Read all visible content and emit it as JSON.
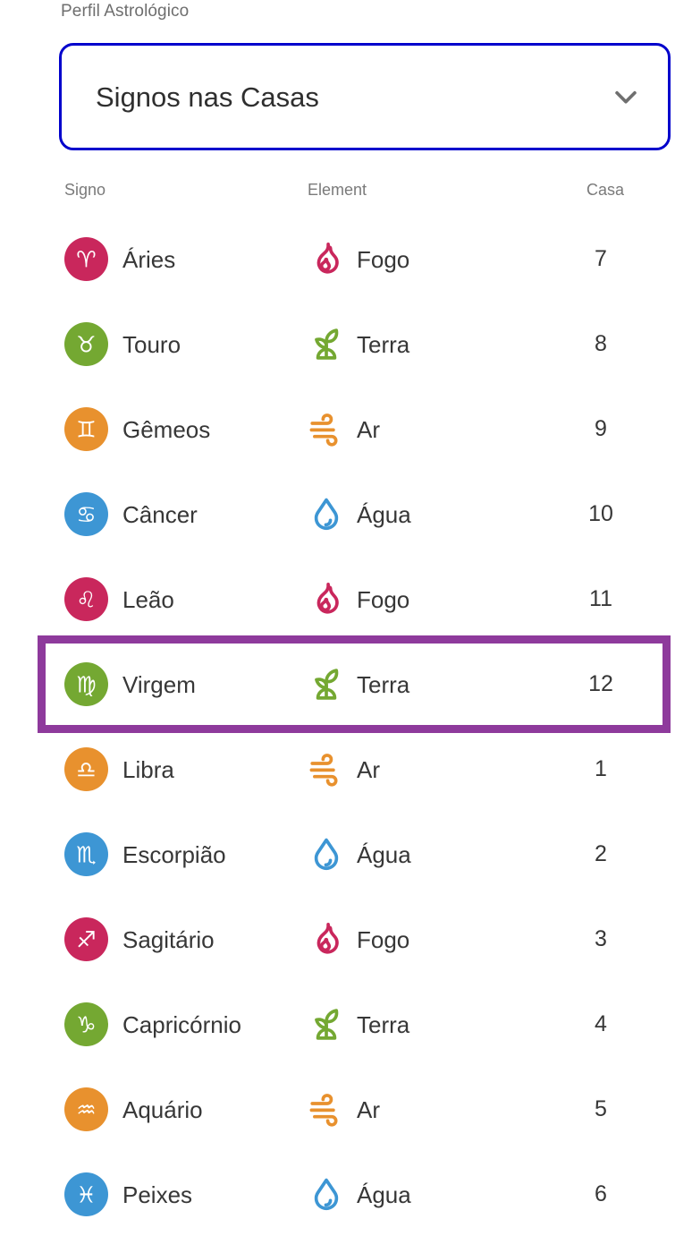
{
  "form": {
    "label": "Perfil Astrológico",
    "select": {
      "name": "perfil-astrologico-select",
      "value": "Signos nas Casas",
      "chevron_icon": "chevron-down-icon",
      "border_color": "#0000cc"
    }
  },
  "table": {
    "headers": {
      "signo": "Signo",
      "element": "Element",
      "casa": "Casa"
    },
    "highlight": {
      "row_index": 5,
      "row_label": "Virgem",
      "color": "#8e3a9c"
    },
    "rows": [
      {
        "sign": "Áries",
        "sign_glyph": "♈",
        "sign_color": "#c9275c",
        "element": "Fogo",
        "element_icon": "flame-icon",
        "element_color": "#c9275c",
        "house": "7"
      },
      {
        "sign": "Touro",
        "sign_glyph": "♉",
        "sign_color": "#74a832",
        "element": "Terra",
        "element_icon": "sprout-icon",
        "element_color": "#74a832",
        "house": "8"
      },
      {
        "sign": "Gêmeos",
        "sign_glyph": "♊",
        "sign_color": "#e8912e",
        "element": "Ar",
        "element_icon": "wind-icon",
        "element_color": "#e8912e",
        "house": "9"
      },
      {
        "sign": "Câncer",
        "sign_glyph": "♋",
        "sign_color": "#3d96d4",
        "element": "Água",
        "element_icon": "droplet-icon",
        "element_color": "#3d96d4",
        "house": "10"
      },
      {
        "sign": "Leão",
        "sign_glyph": "♌",
        "sign_color": "#c9275c",
        "element": "Fogo",
        "element_icon": "flame-icon",
        "element_color": "#c9275c",
        "house": "11"
      },
      {
        "sign": "Virgem",
        "sign_glyph": "♍",
        "sign_color": "#74a832",
        "element": "Terra",
        "element_icon": "sprout-icon",
        "element_color": "#74a832",
        "house": "12"
      },
      {
        "sign": "Libra",
        "sign_glyph": "♎",
        "sign_color": "#e8912e",
        "element": "Ar",
        "element_icon": "wind-icon",
        "element_color": "#e8912e",
        "house": "1"
      },
      {
        "sign": "Escorpião",
        "sign_glyph": "♏",
        "sign_color": "#3d96d4",
        "element": "Água",
        "element_icon": "droplet-icon",
        "element_color": "#3d96d4",
        "house": "2"
      },
      {
        "sign": "Sagitário",
        "sign_glyph": "♐",
        "sign_color": "#c9275c",
        "element": "Fogo",
        "element_icon": "flame-icon",
        "element_color": "#c9275c",
        "house": "3"
      },
      {
        "sign": "Capricórnio",
        "sign_glyph": "♑",
        "sign_color": "#74a832",
        "element": "Terra",
        "element_icon": "sprout-icon",
        "element_color": "#74a832",
        "house": "4"
      },
      {
        "sign": "Aquário",
        "sign_glyph": "♒",
        "sign_color": "#e8912e",
        "element": "Ar",
        "element_icon": "wind-icon",
        "element_color": "#e8912e",
        "house": "5"
      },
      {
        "sign": "Peixes",
        "sign_glyph": "♓",
        "sign_color": "#3d96d4",
        "element": "Água",
        "element_icon": "droplet-icon",
        "element_color": "#3d96d4",
        "house": "6"
      }
    ]
  }
}
